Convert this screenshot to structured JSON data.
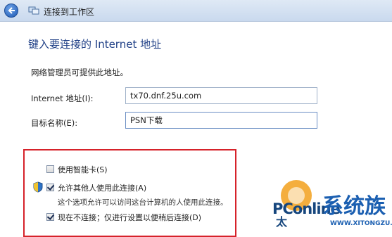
{
  "window": {
    "title": "连接到工作区"
  },
  "main": {
    "heading": "键入要连接的 Internet 地址",
    "note": "网络管理员可提供此地址。",
    "address_label": "Internet 地址(I):",
    "address_value": "tx70.dnf.25u.com",
    "dest_label": "目标名称(E):",
    "dest_value": "PSN下载"
  },
  "options": {
    "smartcard_label": "使用智能卡(S)",
    "smartcard_checked": false,
    "allow_others_label": "允许其他人使用此连接(A)",
    "allow_others_checked": true,
    "allow_others_desc": "这个选项允许可以访问这台计算机的人使用此连接。",
    "dont_connect_label": "现在不连接；仅进行设置以便稍后连接(D)",
    "dont_connect_checked": true
  },
  "watermarks": {
    "pconline": "PConline",
    "pconline_sub": "太",
    "system_site": "系统族",
    "system_url": "WWW.XITONGZU.COM"
  },
  "colors": {
    "heading": "#1f3f86",
    "highlight_box": "#d6222a",
    "titlebar": "#c9d9ee"
  }
}
